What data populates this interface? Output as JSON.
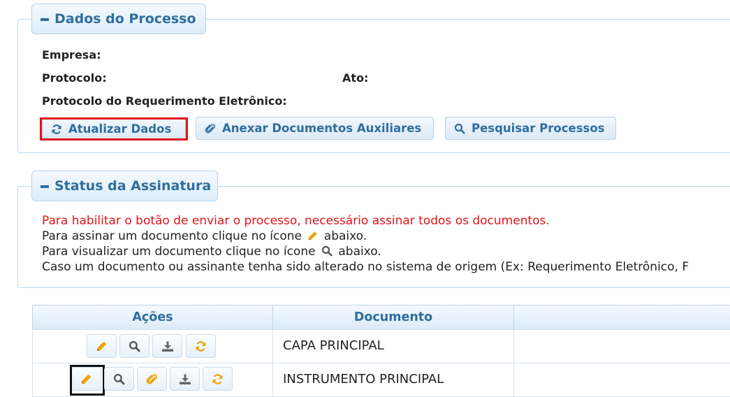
{
  "process_panel": {
    "legend": "Dados do Processo",
    "empresa_label": "Empresa:",
    "protocolo_label": "Protocolo:",
    "ato_label": "Ato:",
    "protocolo_req_label": "Protocolo do Requerimento Eletrônico:",
    "buttons": {
      "atualizar": "Atualizar Dados",
      "anexar": "Anexar Documentos Auxiliares",
      "pesquisar": "Pesquisar Processos"
    }
  },
  "status_panel": {
    "legend": "Status da Assinatura",
    "warning": "Para habilitar o botão de enviar o processo, necessário assinar todos os documentos.",
    "sign_prefix": "Para assinar um documento clique no ícone",
    "sign_suffix": "abaixo.",
    "view_prefix": "Para visualizar um documento clique no ícone",
    "view_suffix": "abaixo.",
    "changed_line": "Caso um documento ou assinante tenha sido alterado no sistema de origem (Ex: Requerimento Eletrônico, F"
  },
  "table": {
    "headers": [
      "Ações",
      "Documento",
      ""
    ],
    "rows": [
      {
        "document": "CAPA PRINCIPAL"
      },
      {
        "document": "INSTRUMENTO PRINCIPAL"
      }
    ]
  },
  "colors": {
    "accent": "#2e6e9e",
    "warning": "#e0141b",
    "edit_icon": "#f0a30a"
  },
  "icons": [
    "minus-icon",
    "refresh-icon",
    "paperclip-icon",
    "search-icon",
    "pencil-icon",
    "download-icon"
  ]
}
